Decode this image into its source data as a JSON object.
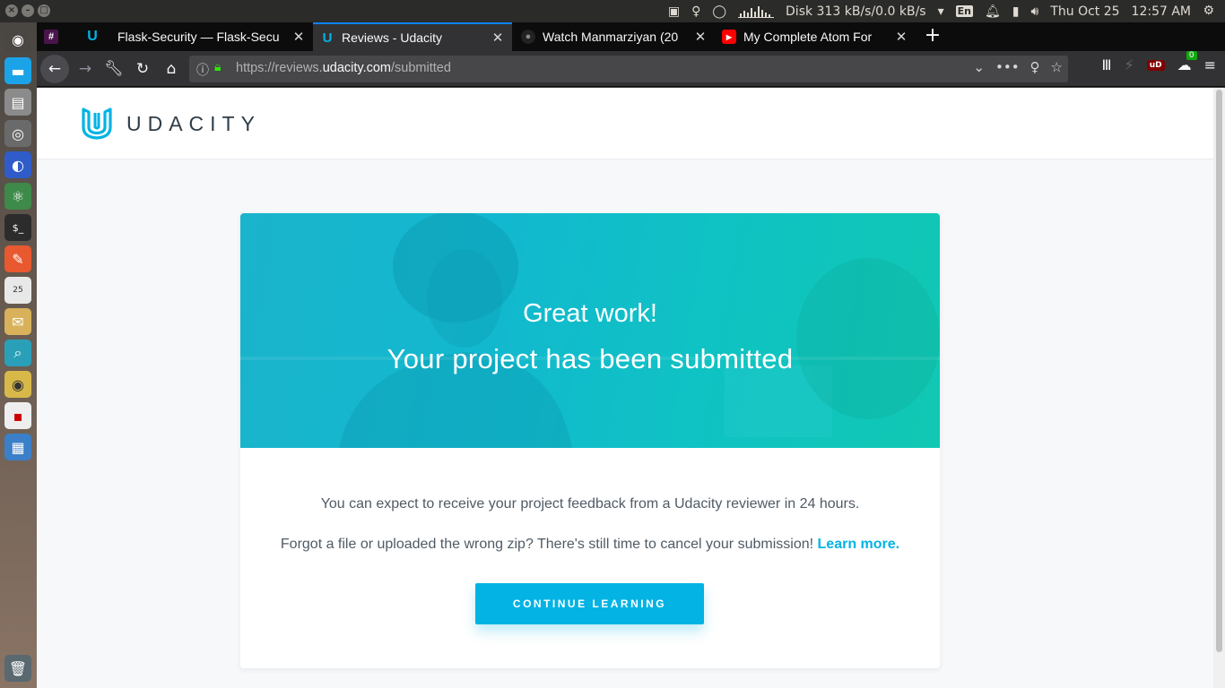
{
  "system_panel": {
    "disk": "Disk 313 kB/s/0.0 kB/s",
    "keyboard": "En",
    "datetime": "Thu Oct 25",
    "clock": "12:57 AM"
  },
  "tabs": [
    {
      "label": "",
      "favicon": "hash-icon"
    },
    {
      "label": "",
      "favicon": "udacity-icon"
    },
    {
      "label": "Flask-Security — Flask-Secu",
      "favicon": "flask-icon"
    },
    {
      "label": "Reviews - Udacity",
      "favicon": "udacity-icon"
    },
    {
      "label": "Watch Manmarziyan (20",
      "favicon": "globe-icon"
    },
    {
      "label": "My Complete Atom For",
      "favicon": "youtube-icon"
    }
  ],
  "urlbar": {
    "prefix": "https://reviews.",
    "domain": "udacity.com",
    "path": "/submitted"
  },
  "toolbar": {
    "ublock_label": "uD",
    "badge_count": "0"
  },
  "site": {
    "logo_text": "UDACITY"
  },
  "hero": {
    "title": "Great work!",
    "subtitle": "Your project has been submitted"
  },
  "content": {
    "line1": "You can expect to receive your project feedback from a Udacity reviewer in 24 hours.",
    "line2": "Forgot a file or uploaded the wrong zip? There's still time to cancel your submission!",
    "learn_more": "Learn more.",
    "cta": "CONTINUE LEARNING"
  },
  "colors": {
    "brand": "#02b3e4",
    "hero_start": "#1ab4cc",
    "hero_end": "#10c8b3",
    "text": "#4f5b66",
    "tab_accent": "#0a84ff"
  }
}
